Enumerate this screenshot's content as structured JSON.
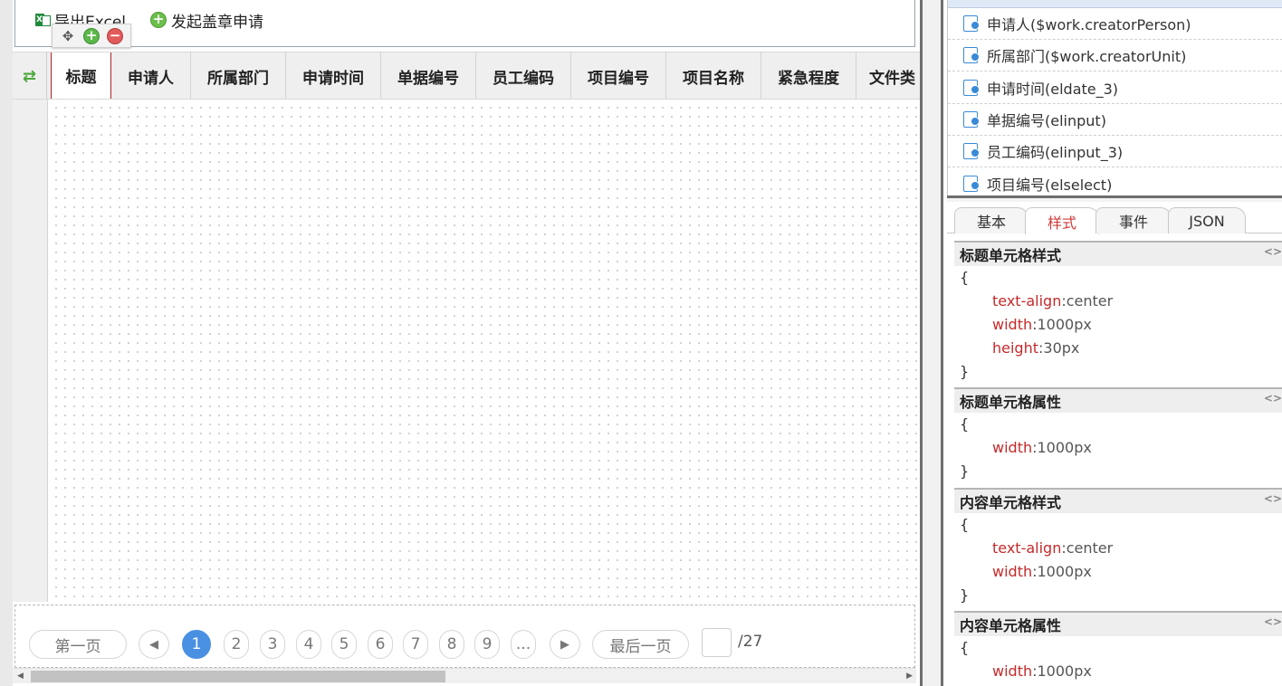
{
  "toolbar": {
    "export_label": "导出Excel",
    "excel_icon_letter": "X",
    "seal_label": "发起盖章申请"
  },
  "float_tools": {
    "move_glyph": "✥",
    "add_glyph": "+",
    "remove_glyph": "−"
  },
  "grid": {
    "refresh_glyph": "⇄",
    "columns": [
      "标题",
      "申请人",
      "所属部门",
      "申请时间",
      "单据编号",
      "员工编码",
      "项目编号",
      "项目名称",
      "紧急程度",
      "文件类"
    ]
  },
  "pager": {
    "first_label": "第一页",
    "prev_glyph": "◀",
    "pages": [
      "1",
      "2",
      "3",
      "4",
      "5",
      "6",
      "7",
      "8",
      "9",
      "..."
    ],
    "current_page": "1",
    "next_glyph": "▶",
    "last_label": "最后一页",
    "page_input_value": "",
    "total": "/27"
  },
  "field_list": {
    "items": [
      "申请人($work.creatorPerson)",
      "所属部门($work.creatorUnit)",
      "申请时间(eldate_3)",
      "单据编号(elinput)",
      "员工编码(elinput_3)",
      "项目编号(elselect)"
    ]
  },
  "tabs": [
    "基本",
    "样式",
    "事件",
    "JSON"
  ],
  "active_tab": "样式",
  "props": [
    {
      "title": "标题单元格样式",
      "open": "{",
      "close": "}",
      "entries": [
        {
          "k": "text-align",
          "v": "center"
        },
        {
          "k": "width",
          "v": "1000px"
        },
        {
          "k": "height",
          "v": "30px"
        }
      ]
    },
    {
      "title": "标题单元格属性",
      "open": "{",
      "close": "}",
      "entries": [
        {
          "k": "width",
          "v": "1000px"
        }
      ]
    },
    {
      "title": "内容单元格样式",
      "open": "{",
      "close": "}",
      "entries": [
        {
          "k": "text-align",
          "v": "center"
        },
        {
          "k": "width",
          "v": "1000px"
        }
      ]
    },
    {
      "title": "内容单元格属性",
      "open": "{",
      "close": "",
      "entries": [
        {
          "k": "width",
          "v": "1000px"
        }
      ]
    }
  ],
  "code_icon": "<>",
  "colors": {
    "accent_blue": "#4a90e2",
    "active_tab_red": "#d23b3b",
    "selected_border": "#b22222",
    "key_red": "#c52a2a"
  }
}
